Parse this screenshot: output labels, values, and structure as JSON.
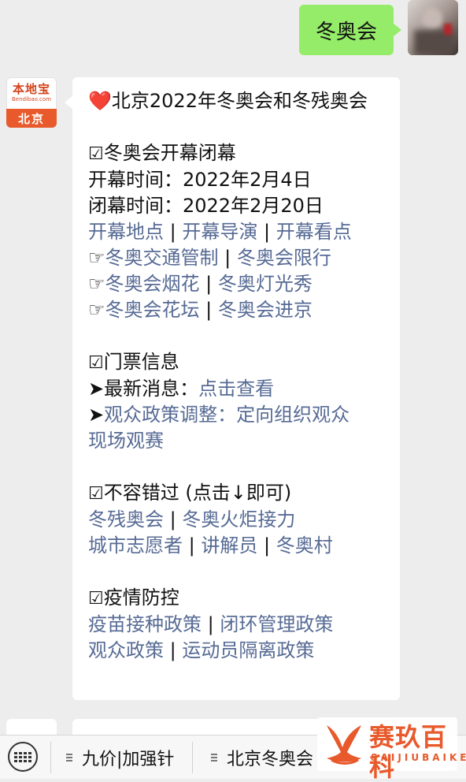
{
  "user_message": {
    "text": "冬奥会"
  },
  "bot_avatar": {
    "name": "本地宝",
    "sub": "Bendibao.com",
    "city": "北京"
  },
  "bot_message": {
    "title": "北京2022年冬奥会和冬残奥会",
    "sections": {
      "opening": {
        "heading": "冬奥会开幕闭幕",
        "open_label": "开幕时间：",
        "open_date": "2022年2月4日",
        "close_label": "闭幕时间：",
        "close_date": "2022年2月20日",
        "links_row1": [
          "开幕地点",
          "开幕导演",
          "开幕看点"
        ],
        "links_row2": [
          "冬奥交通管制",
          "冬奥会限行"
        ],
        "links_row3": [
          "冬奥会烟花",
          "冬奥灯光秀"
        ],
        "links_row4": [
          "冬奥会花坛",
          "冬奥会进京"
        ]
      },
      "tickets": {
        "heading": "门票信息",
        "latest_label": "最新消息：",
        "latest_link": "点击查看",
        "policy_link_line1": "观众政策调整：定向组织观众",
        "policy_link_line2": "现场观赛"
      },
      "must_see": {
        "heading": "不容错过 (点击↓即可)",
        "links_row1": [
          "冬残奥会",
          "冬奥火炬接力"
        ],
        "links_row2": [
          "城市志愿者",
          "讲解员",
          "冬奥村"
        ]
      },
      "epidemic": {
        "heading": "疫情防控",
        "links_row1": [
          "疫苗接种政策",
          "闭环管理政策"
        ],
        "links_row2": [
          "观众政策",
          "运动员隔离政策"
        ]
      }
    },
    "separator": "|",
    "bullet": "➤",
    "pointer": "☞",
    "checkbox": "☑",
    "heart": "❤️"
  },
  "bottom_menu": {
    "items": [
      "九价|加强针",
      "北京冬奥会"
    ]
  },
  "watermark": {
    "text": "赛玖百科",
    "sub": "SAIJIUBAIKE"
  },
  "colors": {
    "link": "#576b95",
    "user_bubble": "#95ec69",
    "brand": "#e8592b"
  }
}
